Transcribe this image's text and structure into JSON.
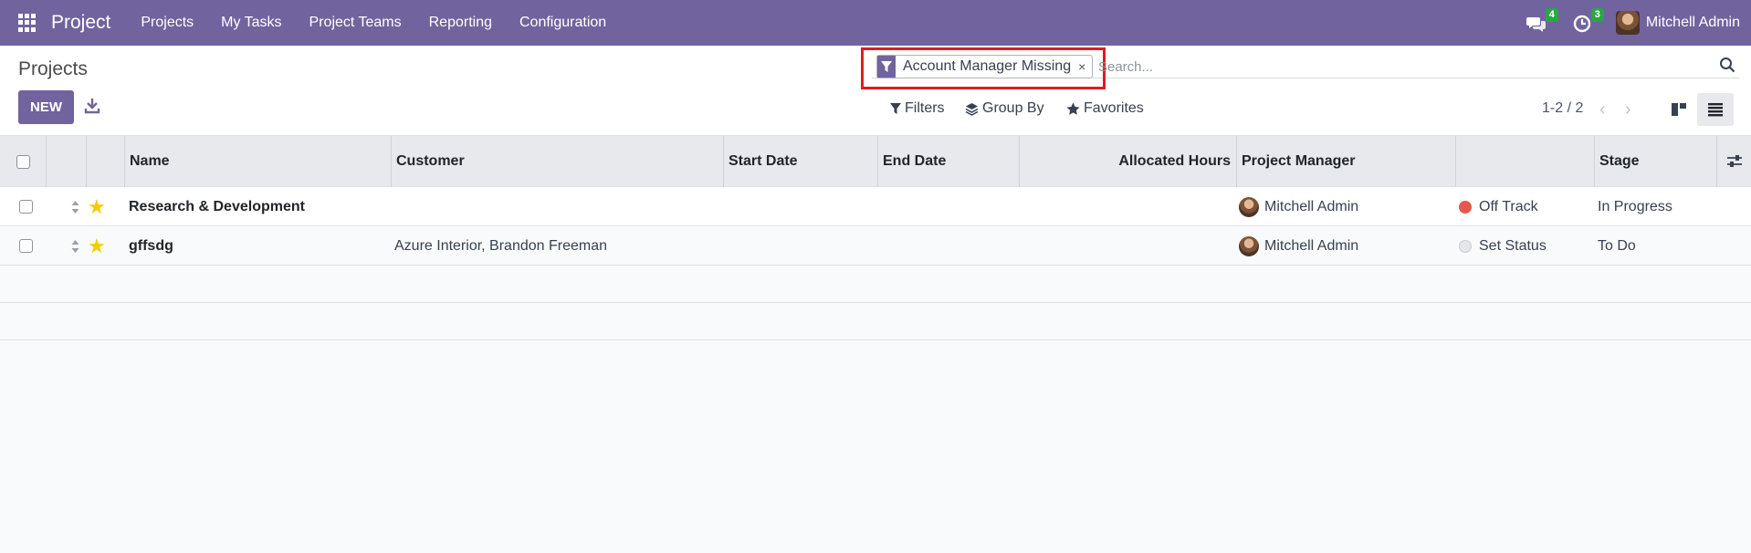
{
  "navbar": {
    "app_name": "Project",
    "menu": [
      "Projects",
      "My Tasks",
      "Project Teams",
      "Reporting",
      "Configuration"
    ],
    "messages_count": "4",
    "activities_count": "3",
    "user_name": "Mitchell Admin"
  },
  "control_panel": {
    "title": "Projects",
    "new_label": "NEW",
    "facet_label": "Account Manager Missing",
    "facet_remove": "×",
    "search_placeholder": "Search...",
    "filters_label": "Filters",
    "group_by_label": "Group By",
    "favorites_label": "Favorites",
    "pager": "1-2 / 2"
  },
  "table": {
    "columns": [
      "Name",
      "Customer",
      "Start Date",
      "End Date",
      "Allocated Hours",
      "Project Manager",
      "Stage"
    ],
    "rows": [
      {
        "name": "Research & Development",
        "customer": "",
        "start_date": "",
        "end_date": "",
        "allocated_hours": "",
        "manager": "Mitchell Admin",
        "status": "Off Track",
        "status_color": "#e6574e",
        "stage": "In Progress"
      },
      {
        "name": "gffsdg",
        "customer": "Azure Interior, Brandon Freeman",
        "start_date": "",
        "end_date": "",
        "allocated_hours": "",
        "manager": "Mitchell Admin",
        "status": "Set Status",
        "status_color": "#e5e7ea",
        "stage": "To Do"
      }
    ]
  },
  "colors": {
    "brand": "#71639e",
    "highlight": "#e01b24",
    "badge": "#28a745",
    "star": "#f3cc00"
  }
}
